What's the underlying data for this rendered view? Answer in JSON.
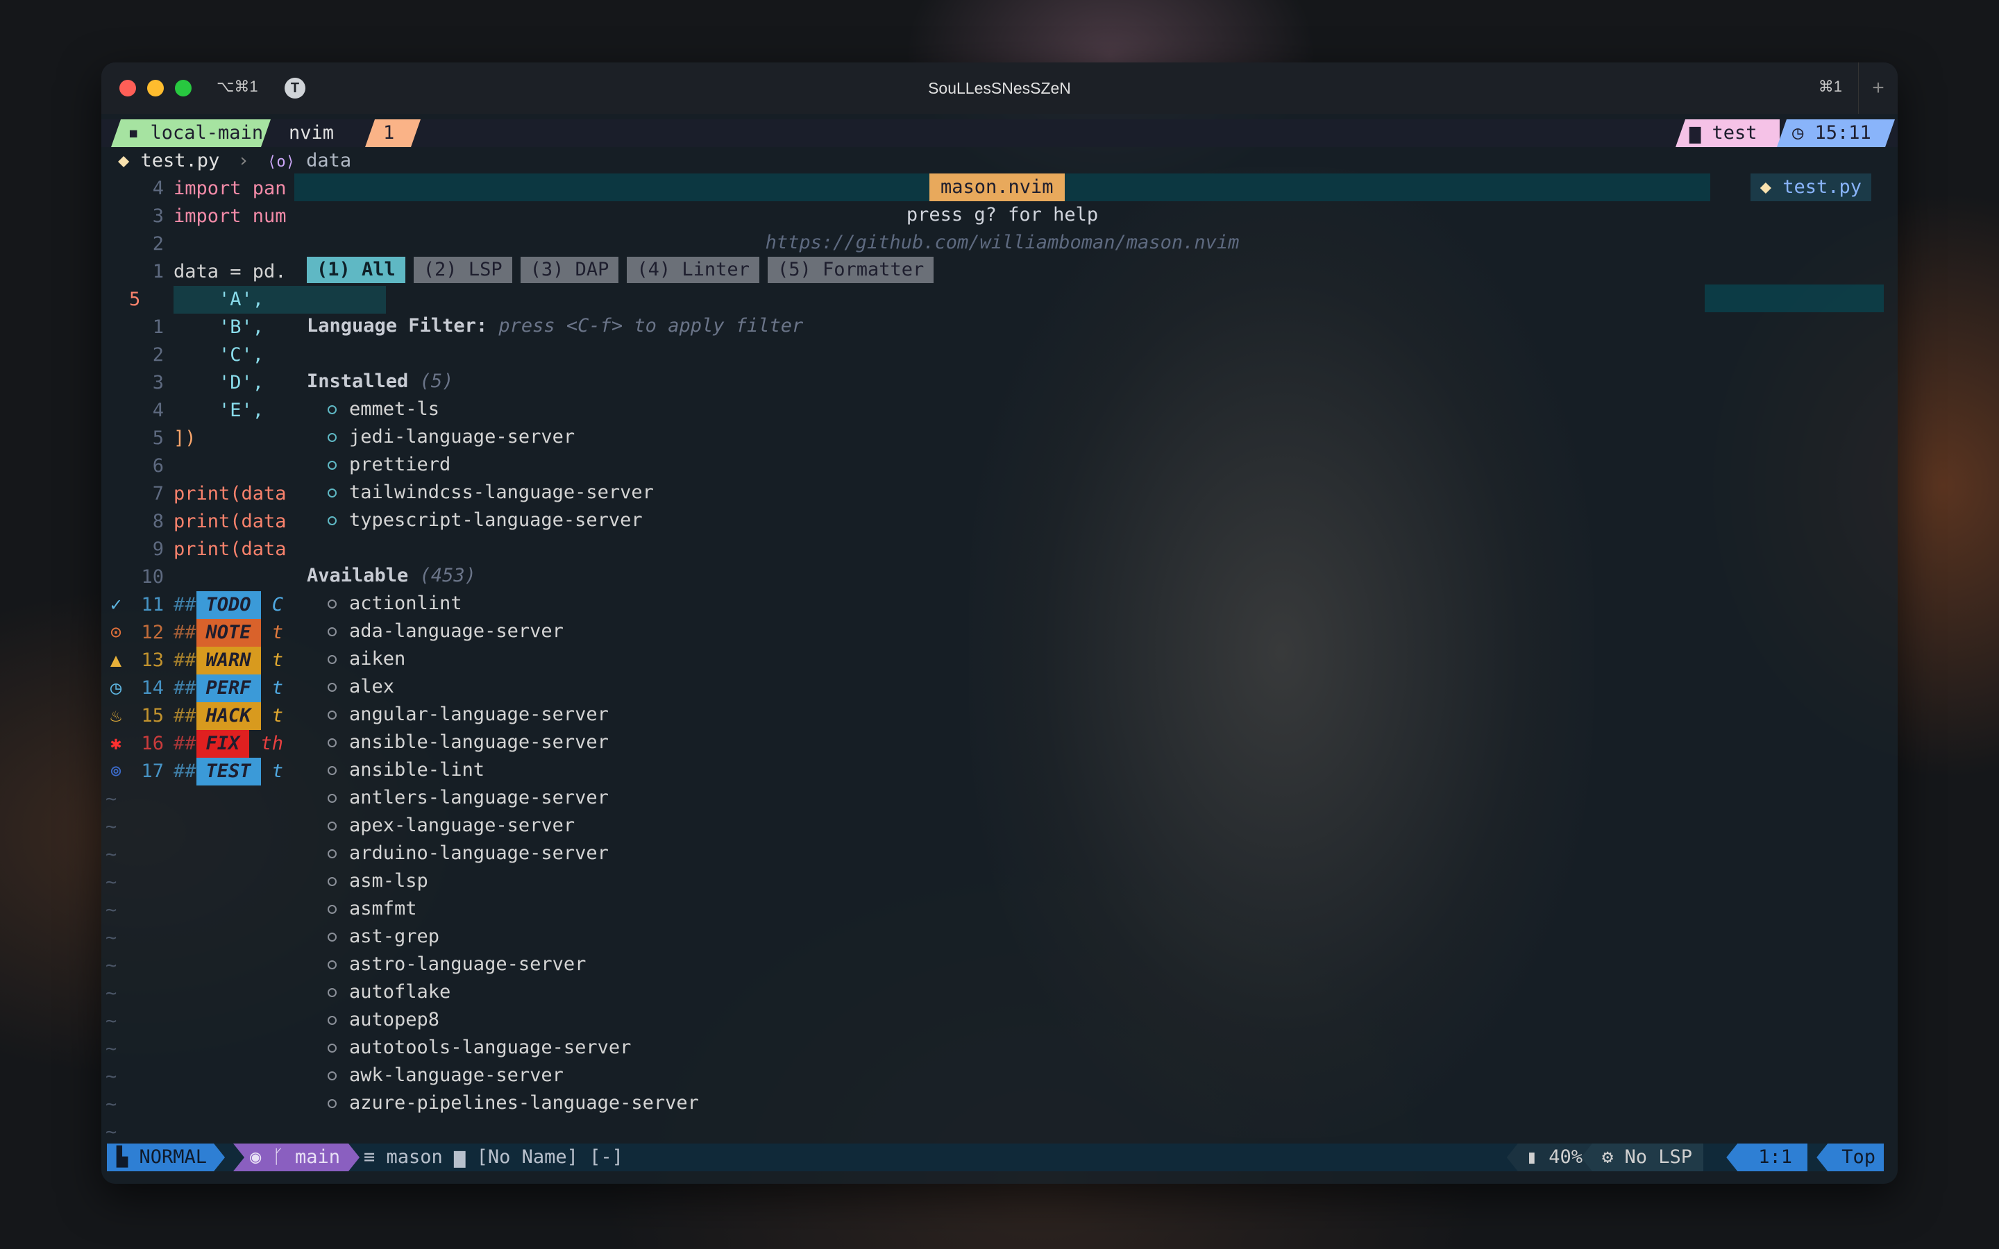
{
  "titlebar": {
    "shortcut_left": "⌥⌘1",
    "tab_icon": "T",
    "title": "SouLLesSNesSZeN",
    "shortcut_right": "⌘1",
    "new_tab": "+"
  },
  "tmux": {
    "session": "local-main",
    "window": "nvim",
    "window_num": "1",
    "dir": "test",
    "time": "15:11"
  },
  "winbar": {
    "file": "test.py",
    "symbol": "data"
  },
  "editor": {
    "lines": [
      {
        "num": "4",
        "text": "import pan"
      },
      {
        "num": "3",
        "text": "import num"
      },
      {
        "num": "2",
        "text": ""
      },
      {
        "num": "1",
        "text": "data = pd."
      },
      {
        "num": "5",
        "text": "    'A',"
      },
      {
        "num": "1",
        "text": "    'B',"
      },
      {
        "num": "2",
        "text": "    'C',"
      },
      {
        "num": "3",
        "text": "    'D',"
      },
      {
        "num": "4",
        "text": "    'E',"
      },
      {
        "num": "5",
        "text": "])"
      },
      {
        "num": "6",
        "text": ""
      },
      {
        "num": "7",
        "text": "print(data"
      },
      {
        "num": "8",
        "text": "print(data"
      },
      {
        "num": "9",
        "text": "print(data"
      },
      {
        "num": "10",
        "text": ""
      }
    ],
    "todo_lines": [
      {
        "num": "11",
        "tag": "TODO",
        "rest": "C",
        "color": "#3b9ad8",
        "restColor": "#4fa8e0",
        "signColor": "#5fb8e4"
      },
      {
        "num": "12",
        "tag": "NOTE",
        "rest": "t",
        "color": "#d9622b",
        "restColor": "#e07a3e",
        "signColor": "#e0703a"
      },
      {
        "num": "13",
        "tag": "WARN",
        "rest": "t",
        "color": "#d89a1e",
        "restColor": "#e0a830",
        "signColor": "#e6b03a"
      },
      {
        "num": "14",
        "tag": "PERF",
        "rest": "t",
        "color": "#3b9ad8",
        "restColor": "#4fa8e0",
        "signColor": "#5fb8e4"
      },
      {
        "num": "15",
        "tag": "HACK",
        "rest": "t",
        "color": "#d89a1e",
        "restColor": "#e0a830",
        "signColor": "#e6b03a"
      },
      {
        "num": "16",
        "tag": "FIX",
        "rest": "th",
        "color": "#e02020",
        "restColor": "#e84040",
        "signColor": "#ff3030"
      },
      {
        "num": "17",
        "tag": "TEST",
        "rest": "t",
        "color": "#3b9ad8",
        "restColor": "#4fa8e0",
        "signColor": "#3b6ac8"
      }
    ],
    "prefix": "##",
    "right_tab": "test.py"
  },
  "mason": {
    "title": "mason.nvim",
    "help": "press g? for help",
    "url": "https://github.com/williamboman/mason.nvim",
    "tabs": [
      "(1) All",
      "(2) LSP",
      "(3) DAP",
      "(4) Linter",
      "(5) Formatter"
    ],
    "filter_label": "Language Filter:",
    "filter_hint": "press <C-f> to apply filter",
    "installed_label": "Installed",
    "installed_count": "(5)",
    "installed": [
      "emmet-ls",
      "jedi-language-server",
      "prettierd",
      "tailwindcss-language-server",
      "typescript-language-server"
    ],
    "available_label": "Available",
    "available_count": "(453)",
    "available": [
      "actionlint",
      "ada-language-server",
      "aiken",
      "alex",
      "angular-language-server",
      "ansible-language-server",
      "ansible-lint",
      "antlers-language-server",
      "apex-language-server",
      "arduino-language-server",
      "asm-lsp",
      "asmfmt",
      "ast-grep",
      "astro-language-server",
      "autoflake",
      "autopep8",
      "autotools-language-server",
      "awk-language-server",
      "azure-pipelines-language-server"
    ]
  },
  "statusline": {
    "mode": "NORMAL",
    "branch": "main",
    "filetype": "mason",
    "buffer": "[No Name] [-]",
    "battery": "40%",
    "lsp": "No LSP",
    "position": "1:1",
    "scroll": "Top"
  }
}
